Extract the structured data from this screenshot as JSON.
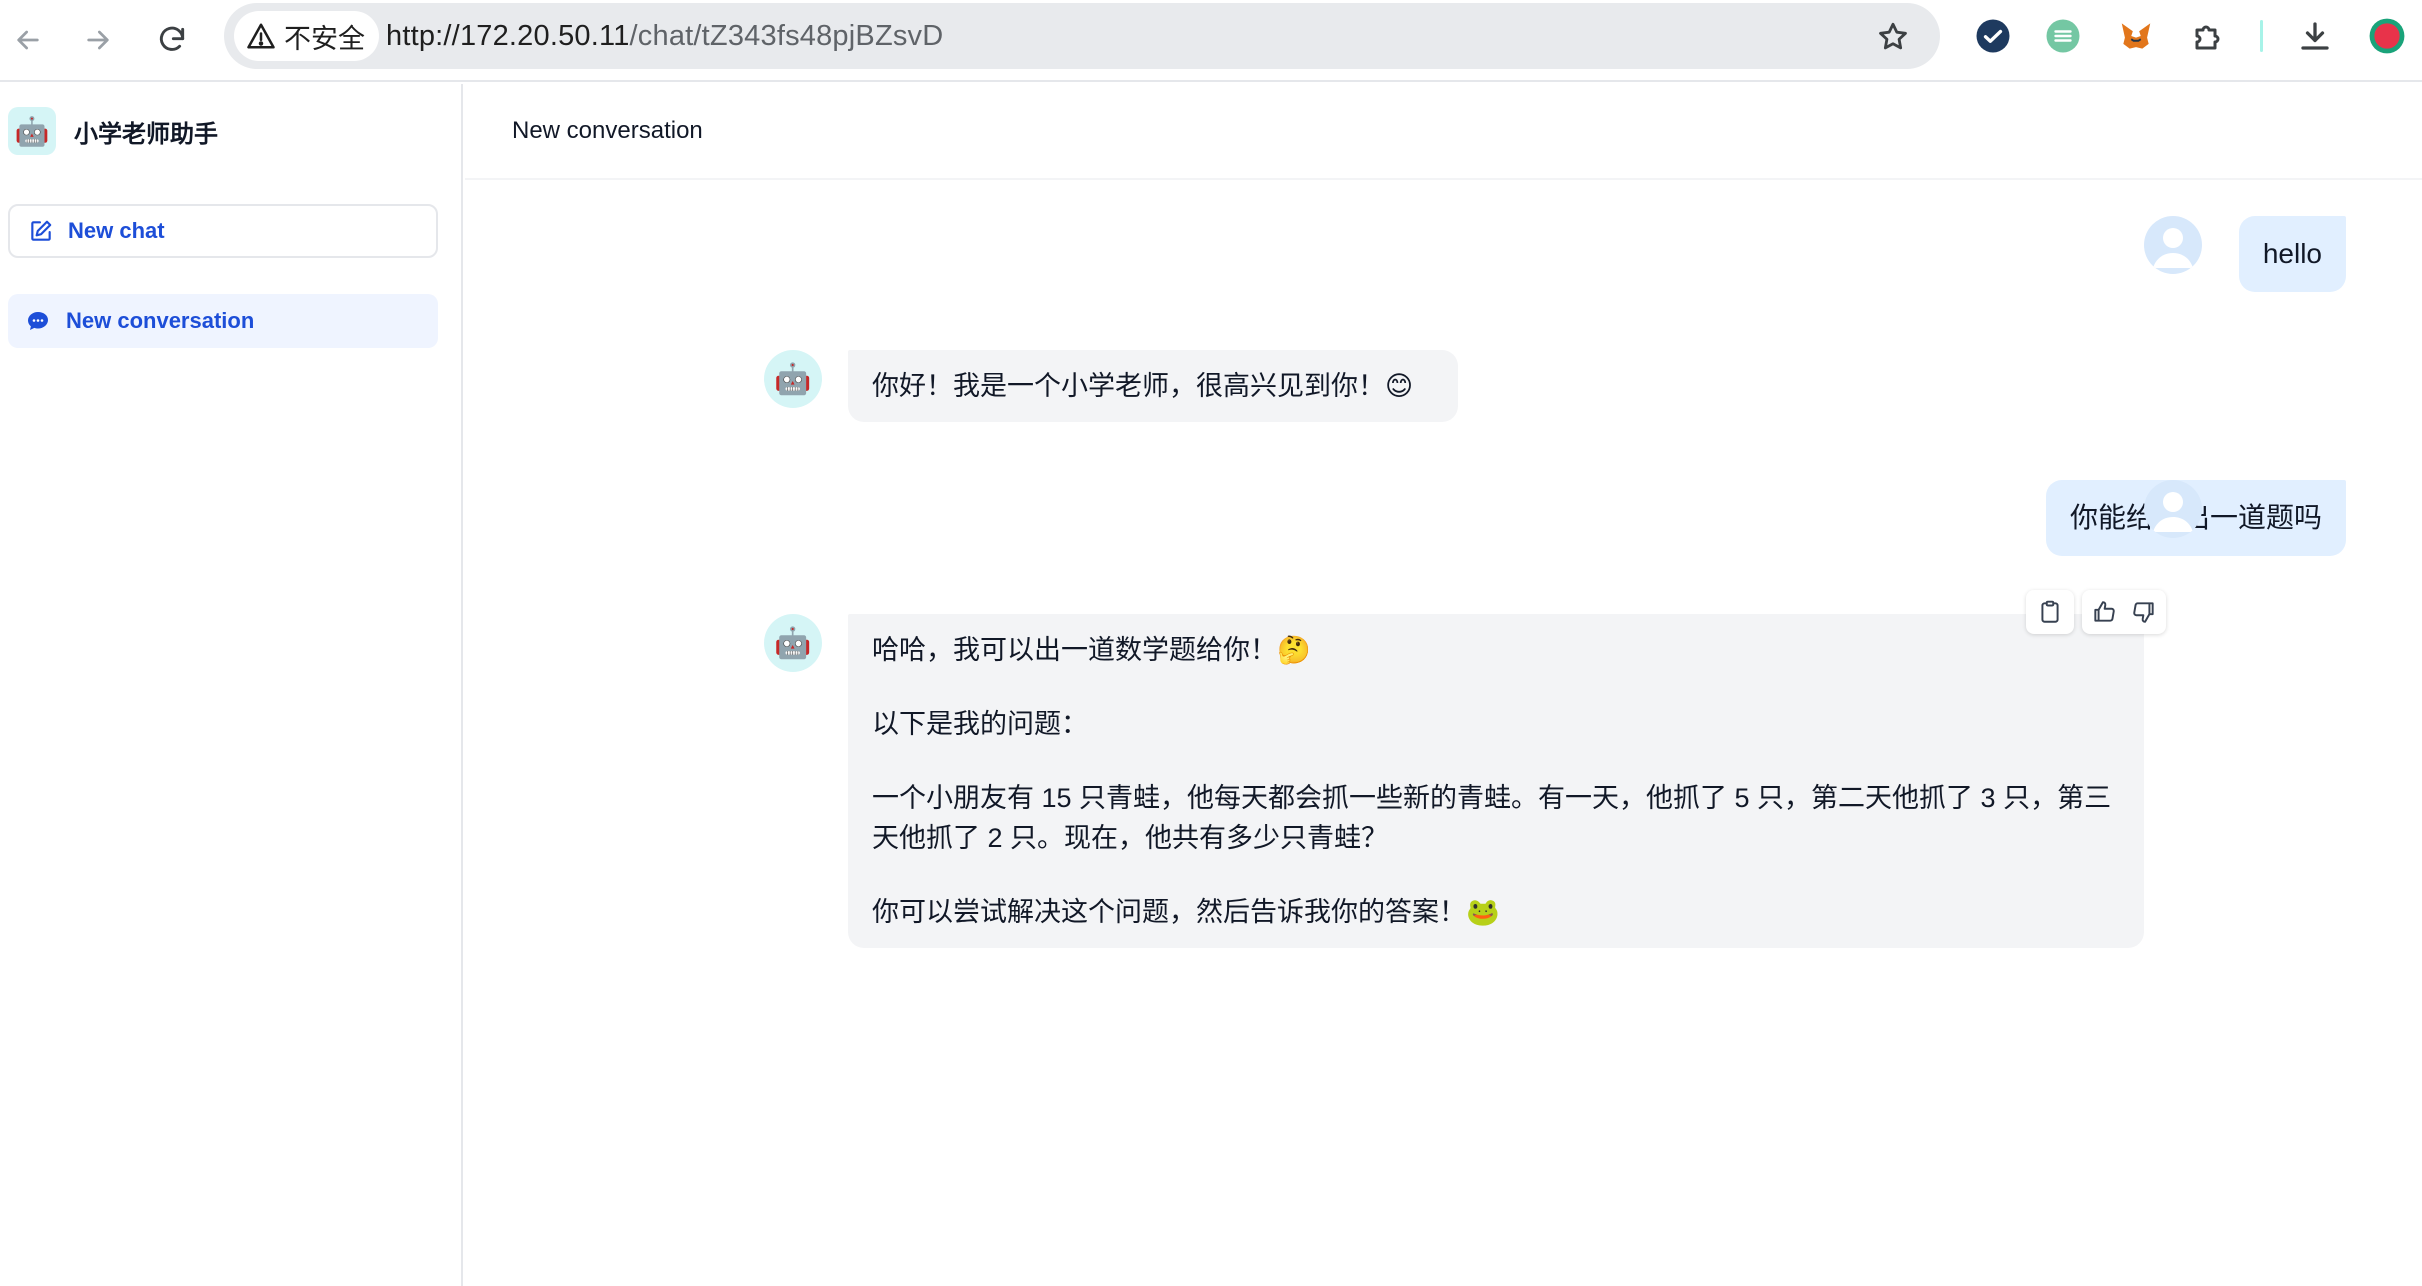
{
  "browser": {
    "security_label": "不安全",
    "url_host": "http://172.20.50.11",
    "url_path": "/chat/tZ343fs48pjBZsvD"
  },
  "sidebar": {
    "app_logo": "🤖",
    "app_title": "小学老师助手",
    "new_chat_label": "New chat",
    "conversations": [
      {
        "label": "New conversation",
        "active": true
      }
    ]
  },
  "main": {
    "title": "New conversation",
    "bot_avatar": "🤖",
    "messages": [
      {
        "role": "user",
        "text": "hello"
      },
      {
        "role": "bot",
        "paragraphs": [
          "你好！我是一个小学老师，很高兴见到你！😊"
        ]
      },
      {
        "role": "user",
        "text": "你能给我出一道题吗"
      },
      {
        "role": "bot",
        "paragraphs": [
          "哈哈，我可以出一道数学题给你！🤔",
          "以下是我的问题：",
          "一个小朋友有 15 只青蛙，他每天都会抓一些新的青蛙。有一天，他抓了 5 只，第二天他抓了 3 只，第三天他抓了 2 只。现在，他共有多少只青蛙？",
          "你可以尝试解决这个问题，然后告诉我你的答案！🐸"
        ]
      }
    ]
  },
  "colors": {
    "accent": "#1d4ed8",
    "user_bubble": "#e1efff",
    "bot_bubble": "#f3f4f6"
  }
}
